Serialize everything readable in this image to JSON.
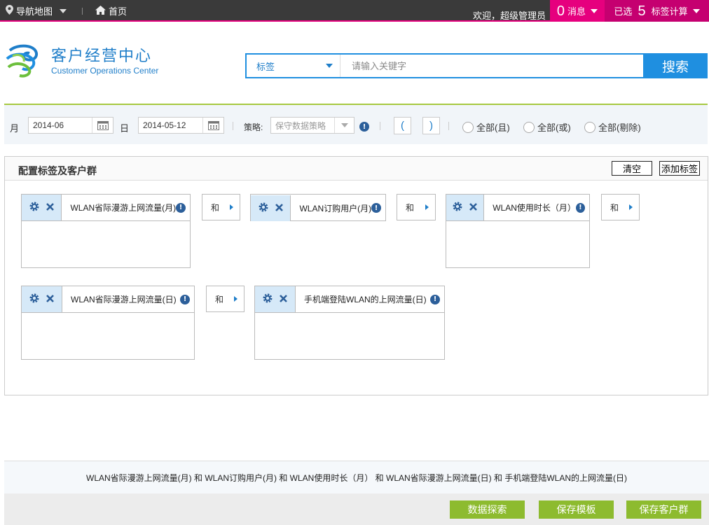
{
  "topbar": {
    "nav_map": "导航地图",
    "home": "首页",
    "welcome": "欢迎，超级管理员",
    "msg_count": "0",
    "msg_label": "消息",
    "selected_prefix": "已选",
    "selected_count": "5",
    "selected_label": "标签计算",
    "icons": [
      "location-pin-icon",
      "home-icon",
      "chevron-down-icon"
    ]
  },
  "brand": {
    "title": "客户经营中心",
    "subtitle": "Customer Operations Center"
  },
  "search": {
    "type_label": "标签",
    "placeholder": "请输入关键字",
    "button": "搜索"
  },
  "filter": {
    "month_label": "月",
    "month_value": "2014-06",
    "day_label": "日",
    "day_value": "2014-05-12",
    "strategy_label": "策略:",
    "strategy_placeholder": "保守数据策略",
    "open_paren": "(",
    "close_paren": ")",
    "radio_and": "全部(且)",
    "radio_or": "全部(或)",
    "radio_exclude": "全部(剔除)"
  },
  "panel": {
    "title": "配置标签及客户群",
    "clear": "清空",
    "add_tag": "添加标签",
    "tags": [
      "WLAN省际漫游上网流量(月)",
      "WLAN订购用户(月)",
      "WLAN使用时长（月）",
      "WLAN省际漫游上网流量(日)",
      "手机端登陆WLAN的上网流量(日)"
    ],
    "connectors": [
      "和",
      "和",
      "和",
      "和"
    ]
  },
  "footer": {
    "expression": "WLAN省际漫游上网流量(月) 和 WLAN订购用户(月) 和 WLAN使用时长（月） 和 WLAN省际漫游上网流量(日) 和 手机端登陆WLAN的上网流量(日)",
    "explore": "数据探索",
    "save_template": "保存模板",
    "save_group": "保存客户群"
  },
  "colors": {
    "accent_pink": "#e6007e",
    "brand_blue": "#1f8fe0",
    "button_green": "#8dbb2f"
  }
}
